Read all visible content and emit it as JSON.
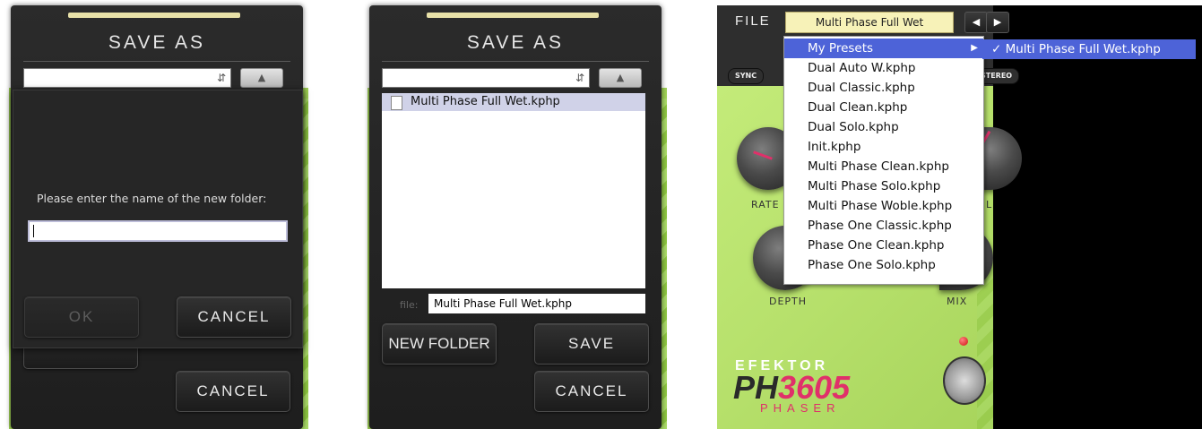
{
  "panel1": {
    "title": "SAVE AS",
    "prompt": "Please enter the name of the new folder:",
    "ok_label": "OK",
    "cancel_label": "CANCEL",
    "cancel_label_2": "CANCEL"
  },
  "panel2": {
    "title": "SAVE AS",
    "files": [
      "Multi Phase Full Wet.kphp"
    ],
    "file_label": "file:",
    "file_value": "Multi Phase Full Wet.kphp",
    "new_folder_label": "NEW FOLDER",
    "save_label": "SAVE",
    "cancel_label": "CANCEL"
  },
  "panel3": {
    "file_label": "FILE",
    "preset_name": "Multi Phase Full Wet",
    "sync_label": "SYNC",
    "stereo_label": "STEREO",
    "menu": {
      "my_presets": "My Presets",
      "items": [
        "Dual Auto W.kphp",
        "Dual Classic.kphp",
        "Dual Clean.kphp",
        "Dual Solo.kphp",
        "Init.kphp",
        "Multi Phase Clean.kphp",
        "Multi Phase Solo.kphp",
        "Multi Phase Woble.kphp",
        "Phase One Classic.kphp",
        "Phase One Clean.kphp",
        "Phase One Solo.kphp"
      ]
    },
    "submenu_item": "✓ Multi Phase Full Wet.kphp",
    "knob_labels": {
      "rate": "RATE",
      "level": "L",
      "depth": "DEPTH",
      "mix": "MIX"
    },
    "logo": {
      "brand": "EFEKTOR",
      "model_ph": "PH",
      "model_num": "3605",
      "type": "PHASER"
    }
  },
  "colors": {
    "accent_green": "#9fd155",
    "highlight_blue": "#4d63d8",
    "logo_pink": "#e0306a"
  }
}
